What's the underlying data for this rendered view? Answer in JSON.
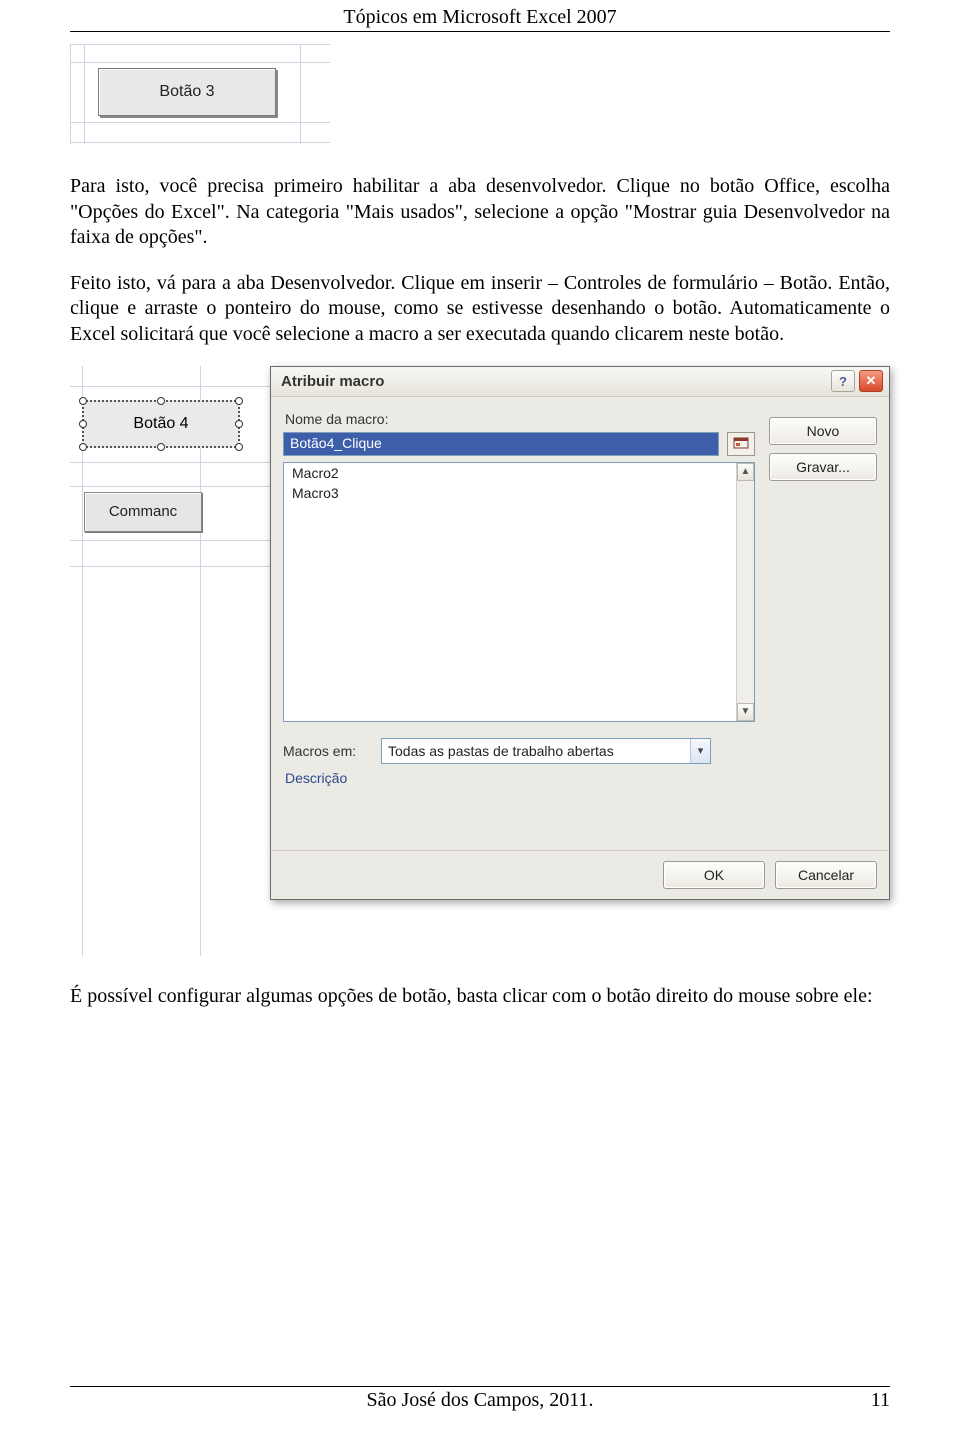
{
  "header": {
    "title": "Tópicos em Microsoft Excel 2007"
  },
  "snippet1": {
    "button_label": "Botão 3"
  },
  "paragraph1": "Para  isto, você precisa primeiro habilitar a aba desenvolvedor. Clique no botão Office, escolha \"Opções do Excel\". Na categoria \"Mais usados\", selecione a opção \"Mostrar guia Desenvolvedor na faixa de opções\".",
  "paragraph2": "Feito isto, vá para a aba Desenvolvedor. Clique em inserir – Controles de formulário – Botão. Então, clique e arraste o ponteiro do mouse, como se estivesse desenhando o botão. Automaticamente o Excel solicitará que você selecione a macro a ser executada quando clicarem neste botão.",
  "snippet2": {
    "button4_label": "Botão 4",
    "command_label": "Commanc"
  },
  "dialog": {
    "title": "Atribuir macro",
    "name_label": "Nome da macro:",
    "name_value": "Botão4_Clique",
    "list_items": [
      "Macro2",
      "Macro3"
    ],
    "btn_novo": "Novo",
    "btn_gravar": "Gravar...",
    "macros_em_label": "Macros em:",
    "macros_em_value": "Todas as pastas de trabalho abertas",
    "descricao_label": "Descrição",
    "btn_ok": "OK",
    "btn_cancel": "Cancelar",
    "help_glyph": "?",
    "close_glyph": "✕"
  },
  "paragraph3": "É possível configurar algumas opções de botão, basta clicar com o botão direito do mouse sobre ele:",
  "footer": {
    "center": "São José dos Campos, 2011.",
    "page_number": "11"
  }
}
